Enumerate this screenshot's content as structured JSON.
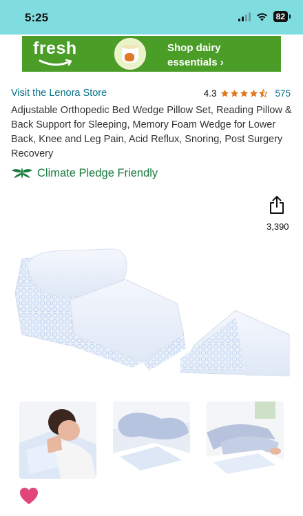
{
  "status_bar": {
    "time": "5:25",
    "battery": "82"
  },
  "banner": {
    "logo_text": "fresh",
    "line1": "Shop dairy",
    "line2": "essentials ›",
    "bg_color": "#4a9d26"
  },
  "product": {
    "store_link": "Visit the Lenora Store",
    "rating_value": "4.3",
    "rating_stars": 4.3,
    "rating_count": "575",
    "title": "Adjustable Orthopedic Bed Wedge Pillow Set, Reading Pillow & Back Support for Sleeping, Memory Foam Wedge for Lower Back, Knee and Leg Pain, Acid Reflux, Snoring, Post Surgery Recovery",
    "pledge_label": "Climate Pledge Friendly",
    "share_count": "3,390"
  },
  "colors": {
    "link": "#007185",
    "star": "#de7921",
    "pledge": "#1a7a3e",
    "heart": "#e0457b",
    "status_bar": "#7fdde0"
  },
  "icons": {
    "share": "share-icon",
    "pledge": "climate-pledge-icon",
    "heart": "heart-icon",
    "wifi": "wifi-icon",
    "signal": "signal-icon",
    "battery": "battery-icon"
  }
}
